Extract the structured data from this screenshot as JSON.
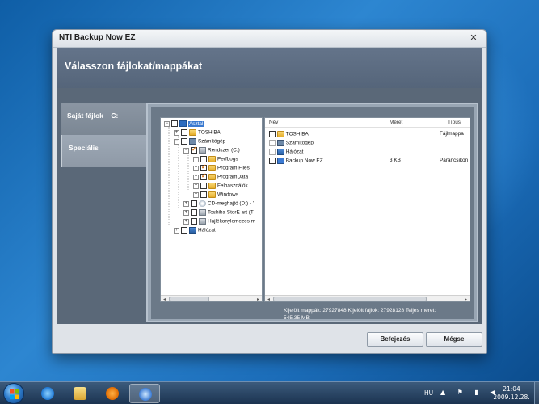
{
  "window": {
    "title": "NTI Backup Now EZ",
    "close_glyph": "✕"
  },
  "page": {
    "title": "Válasszon fájlokat/mappákat"
  },
  "sidebar": {
    "items": [
      {
        "label": "Saját fájlok – C:"
      },
      {
        "label": "Speciális"
      }
    ]
  },
  "tree": {
    "items": [
      {
        "label": "Asztal",
        "icon": "desktop-icon",
        "expander": "−",
        "checked": false,
        "selected": true
      },
      {
        "label": "TOSHIBA",
        "icon": "folder-icon",
        "expander": "+",
        "checked": false
      },
      {
        "label": "Számítógép",
        "icon": "computer-icon",
        "expander": "−",
        "checked": false
      },
      {
        "label": "Rendszer (C:)",
        "icon": "drive-icon",
        "expander": "−",
        "checked": true
      },
      {
        "label": "PerfLogs",
        "icon": "folder-icon",
        "expander": "+",
        "checked": false
      },
      {
        "label": "Program Files",
        "icon": "folder-icon",
        "expander": "+",
        "checked": true
      },
      {
        "label": "ProgramData",
        "icon": "folder-icon",
        "expander": "+",
        "checked": true
      },
      {
        "label": "Felhasználók",
        "icon": "folder-icon",
        "expander": "+",
        "checked": false
      },
      {
        "label": "Windows",
        "icon": "folder-icon",
        "expander": "+",
        "checked": false
      },
      {
        "label": "CD-meghajtó (D:) - '",
        "icon": "cd-icon",
        "expander": "+",
        "checked": false
      },
      {
        "label": "Toshiba StorE art (T",
        "icon": "drive-icon",
        "expander": "+",
        "checked": false
      },
      {
        "label": "Hajlékonylemezes m",
        "icon": "drive-icon",
        "expander": "+",
        "checked": false
      },
      {
        "label": "Hálózat",
        "icon": "network-icon",
        "expander": "+",
        "checked": false
      }
    ]
  },
  "list": {
    "columns": {
      "name": "Név",
      "size": "Méret",
      "type": "Típus"
    },
    "rows": [
      {
        "name": "TOSHIBA",
        "icon": "folder-icon",
        "size": "",
        "type": "Fájlmappa"
      },
      {
        "name": "Számítógép",
        "icon": "computer-icon",
        "size": "",
        "type": ""
      },
      {
        "name": "Hálózat",
        "icon": "network-icon",
        "size": "",
        "type": ""
      },
      {
        "name": "Backup Now EZ",
        "icon": "shortcut-icon",
        "size": "3 KB",
        "type": "Parancsikon"
      }
    ]
  },
  "status": {
    "line1": "Kijelölt mappák: 27927848  Kijelölt fájlok: 27928128  Teljes méret:",
    "line2": "545.35 MB"
  },
  "buttons": {
    "finish": "Befejezés",
    "cancel": "Mégse"
  },
  "scroll": {
    "left_arrow": "◂",
    "right_arrow": "▸"
  },
  "taskbar": {
    "language": "HU",
    "tray_icons": "▲ ⚑ ▮ ◀",
    "time": "21:04",
    "date": "2009.12.28."
  }
}
